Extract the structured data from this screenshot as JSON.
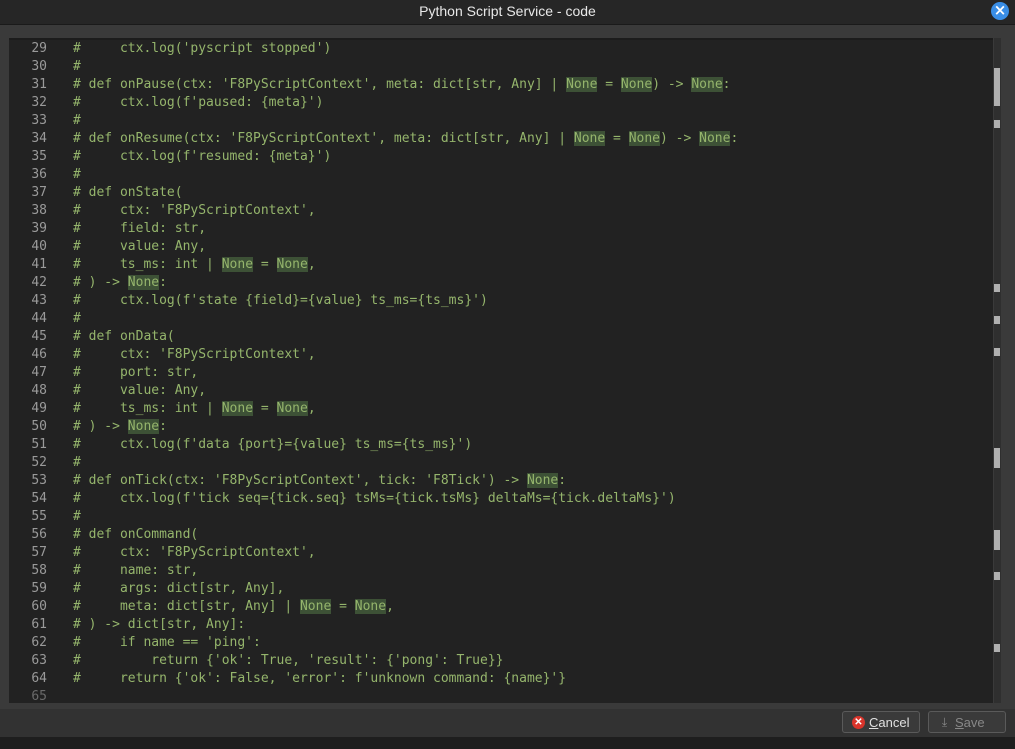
{
  "window": {
    "title": "Python Script Service - code",
    "close_label": "×"
  },
  "editor": {
    "lines": [
      {
        "n": "29",
        "text": "#     ctx.log('pyscript stopped')"
      },
      {
        "n": "30",
        "text": "#"
      },
      {
        "n": "31",
        "text": "# def onPause(ctx: 'F8PyScriptContext', meta: dict[str, Any] | None = None) -> None:"
      },
      {
        "n": "32",
        "text": "#     ctx.log(f'paused: {meta}')"
      },
      {
        "n": "33",
        "text": "#"
      },
      {
        "n": "34",
        "text": "# def onResume(ctx: 'F8PyScriptContext', meta: dict[str, Any] | None = None) -> None:"
      },
      {
        "n": "35",
        "text": "#     ctx.log(f'resumed: {meta}')"
      },
      {
        "n": "36",
        "text": "#"
      },
      {
        "n": "37",
        "text": "# def onState("
      },
      {
        "n": "38",
        "text": "#     ctx: 'F8PyScriptContext',"
      },
      {
        "n": "39",
        "text": "#     field: str,"
      },
      {
        "n": "40",
        "text": "#     value: Any,"
      },
      {
        "n": "41",
        "text": "#     ts_ms: int | None = None,"
      },
      {
        "n": "42",
        "text": "# ) -> None:"
      },
      {
        "n": "43",
        "text": "#     ctx.log(f'state {field}={value} ts_ms={ts_ms}')"
      },
      {
        "n": "44",
        "text": "#"
      },
      {
        "n": "45",
        "text": "# def onData("
      },
      {
        "n": "46",
        "text": "#     ctx: 'F8PyScriptContext',"
      },
      {
        "n": "47",
        "text": "#     port: str,"
      },
      {
        "n": "48",
        "text": "#     value: Any,"
      },
      {
        "n": "49",
        "text": "#     ts_ms: int | None = None,"
      },
      {
        "n": "50",
        "text": "# ) -> None:"
      },
      {
        "n": "51",
        "text": "#     ctx.log(f'data {port}={value} ts_ms={ts_ms}')"
      },
      {
        "n": "52",
        "text": "#"
      },
      {
        "n": "53",
        "text": "# def onTick(ctx: 'F8PyScriptContext', tick: 'F8Tick') -> None:"
      },
      {
        "n": "54",
        "text": "#     ctx.log(f'tick seq={tick.seq} tsMs={tick.tsMs} deltaMs={tick.deltaMs}')"
      },
      {
        "n": "55",
        "text": "#"
      },
      {
        "n": "56",
        "text": "# def onCommand("
      },
      {
        "n": "57",
        "text": "#     ctx: 'F8PyScriptContext',"
      },
      {
        "n": "58",
        "text": "#     name: str,"
      },
      {
        "n": "59",
        "text": "#     args: dict[str, Any],"
      },
      {
        "n": "60",
        "text": "#     meta: dict[str, Any] | None = None,"
      },
      {
        "n": "61",
        "text": "# ) -> dict[str, Any]:"
      },
      {
        "n": "62",
        "text": "#     if name == 'ping':"
      },
      {
        "n": "63",
        "text": "#         return {'ok': True, 'result': {'pong': True}}"
      },
      {
        "n": "64",
        "text": "#     return {'ok': False, 'error': f'unknown command: {name}'}"
      },
      {
        "n": "65",
        "text": ""
      }
    ]
  },
  "footer": {
    "cancel_label": "Cancel",
    "save_label": "Save"
  },
  "colors": {
    "comment": "#95b56c",
    "keyword_highlight": "#3d5136",
    "editor_bg": "#222222"
  }
}
